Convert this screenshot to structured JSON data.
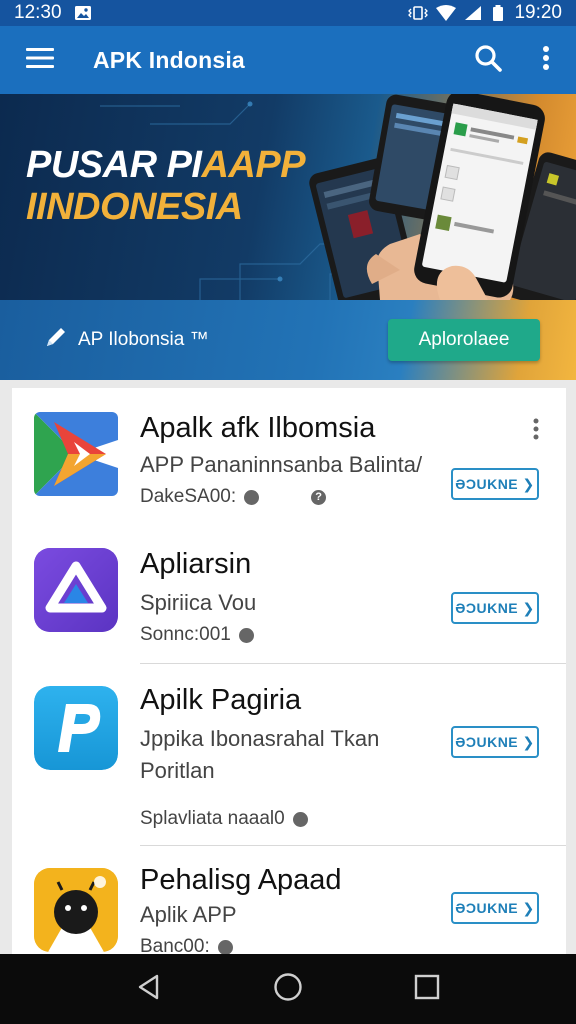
{
  "status_bar": {
    "time_left": "12:30",
    "time_right": "19:20"
  },
  "app_bar": {
    "title": "APK Indonsia"
  },
  "banner": {
    "line1_white": "PUSAR PI",
    "line1_gold": "AAPP",
    "line2": "IINDONESIA"
  },
  "promo": {
    "label": "AP Ilobonsia ™",
    "button_label": "Aplorolaee"
  },
  "apps": [
    {
      "name": "Apalk afk Ilbomsia",
      "desc": [
        "APP Pananinnsanba Balinta/"
      ],
      "meta": "DakeSA00:",
      "button": "ƏƆUKNE ❯"
    },
    {
      "name": "Apliarsin",
      "desc": [
        "Spiriica Vou"
      ],
      "meta": "Sonnc:001",
      "button": "ƏƆUKNE ❯"
    },
    {
      "name": "Apilk Pagiria",
      "desc": [
        "Jppika Ibonasrahal Tkan",
        "Poritlan"
      ],
      "meta": "Splavliata naaal0",
      "button": "ƏƆUKNE ❯"
    },
    {
      "name": "Pehalisg Apaad",
      "desc": [
        "Aplik APP"
      ],
      "meta": "Banc00:",
      "button": "ƏƆUKNE ❯"
    }
  ],
  "colors": {
    "app_bar": "#1b6fbe",
    "status_bar": "#15549f",
    "accent_green": "#1fa98a",
    "outline_blue": "#2a8fc6",
    "gold": "#f2b13a"
  },
  "icons": [
    "menu-icon",
    "search-icon",
    "more-vert-icon",
    "edit-icon",
    "back-icon",
    "home-icon",
    "recents-icon"
  ]
}
